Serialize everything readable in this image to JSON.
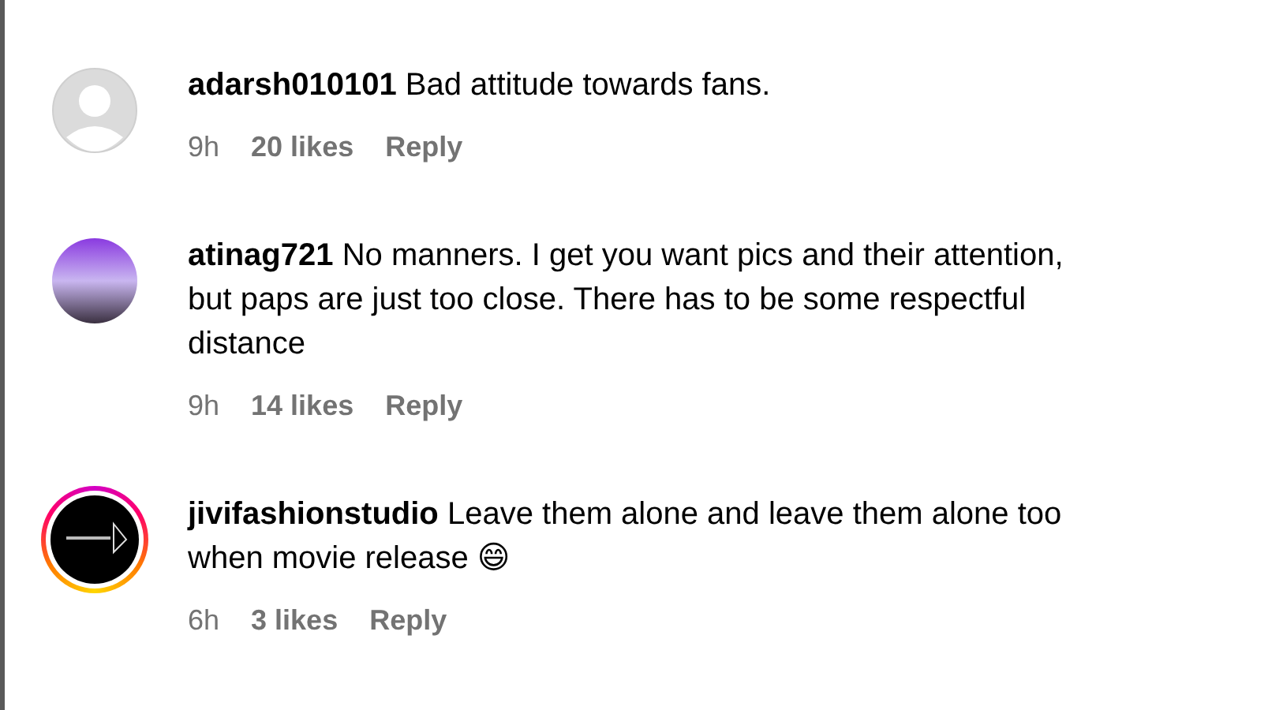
{
  "comments": [
    {
      "avatar": {
        "kind": "default",
        "story_ring": false
      },
      "username": "adarsh010101",
      "text": "Bad attitude towards fans.",
      "time": "9h",
      "likes": "20 likes",
      "reply": "Reply"
    },
    {
      "avatar": {
        "kind": "photo",
        "story_ring": false
      },
      "username": "atinag721",
      "text": "No manners. I get you want pics and their attention, but paps are just too close. There has to be some respectful distance",
      "time": "9h",
      "likes": "14 likes",
      "reply": "Reply"
    },
    {
      "avatar": {
        "kind": "logo",
        "story_ring": true
      },
      "username": "jivifashionstudio",
      "text": "Leave them alone and leave them alone too when movie release 😄",
      "time": "6h",
      "likes": "3 likes",
      "reply": "Reply"
    }
  ]
}
